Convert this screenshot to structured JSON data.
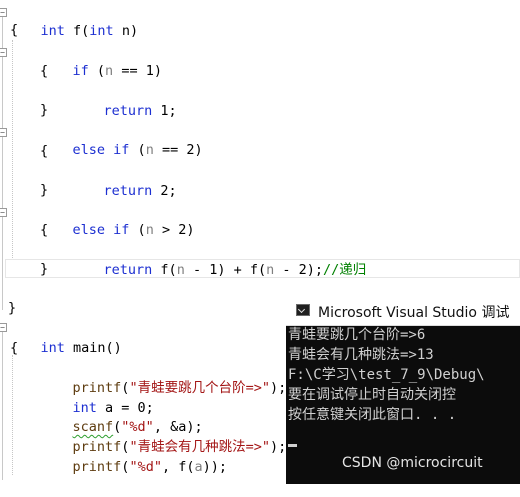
{
  "editor": {
    "lines": {
      "l1": {
        "kw": "int",
        "rest": " f(",
        "kw2": "int",
        "rest2": " n)"
      },
      "l2": {
        "text": "{"
      },
      "l3": {
        "kw": "if",
        "rest": " (",
        "param": "n",
        "rest2": " == 1)"
      },
      "l4": {
        "text": "{"
      },
      "l5": {
        "kw": "return",
        "rest": " 1;"
      },
      "l6": {
        "text": "}"
      },
      "l7": {
        "kw": "else",
        "kw2": " if",
        "rest": " (",
        "param": "n",
        "rest2": " == 2)"
      },
      "l8": {
        "text": "{"
      },
      "l9": {
        "kw": "return",
        "rest": " 2;"
      },
      "l10": {
        "text": "}"
      },
      "l11": {
        "kw": "else",
        "kw2": " if",
        "rest": " (",
        "param": "n",
        "rest2": " > 2)"
      },
      "l12": {
        "text": "{"
      },
      "l13": {
        "kw": "return",
        "rest1": " f(",
        "param1": "n",
        "rest2": " - 1) + f(",
        "param2": "n",
        "rest3": " - 2);",
        "comment": "//递归"
      },
      "l14": {
        "text": "}"
      },
      "l15": {
        "text": "}"
      },
      "l16": {
        "kw": "int",
        "rest": " main()"
      },
      "l17": {
        "text": "{"
      },
      "l18": {
        "fn": "printf",
        "rest": "(",
        "str": "\"青蛙要跳几个台阶=>\"",
        "rest2": ");"
      },
      "l19": {
        "kw": "int",
        "rest": " a = 0;"
      },
      "l20": {
        "fn": "scanf",
        "rest": "(",
        "str": "\"%d\"",
        "rest2": ", &a);"
      },
      "l21": {
        "fn": "printf",
        "rest": "(",
        "str": "\"青蛙会有几种跳法=>\"",
        "rest2": ");"
      },
      "l22": {
        "fn": "printf",
        "rest": "(",
        "str": "\"%d\"",
        "rest2": ", f(",
        "param": "a",
        "rest3": "));"
      }
    },
    "fold_symbol": "−"
  },
  "console": {
    "title": "Microsoft Visual Studio 调试",
    "lines": [
      "青蛙要跳几个台阶=>6",
      "青蛙会有几种跳法=>13",
      "F:\\C学习\\test_7_9\\Debug\\",
      "要在调试停止时自动关闭控",
      "按任意键关闭此窗口. . ."
    ]
  },
  "watermark": "CSDN @microcircuit",
  "colors": {
    "keyword": "#1c2fd1",
    "string": "#a31515",
    "comment": "#008000",
    "console_bg": "#0c0c0c",
    "console_text": "#d0d0d0"
  }
}
